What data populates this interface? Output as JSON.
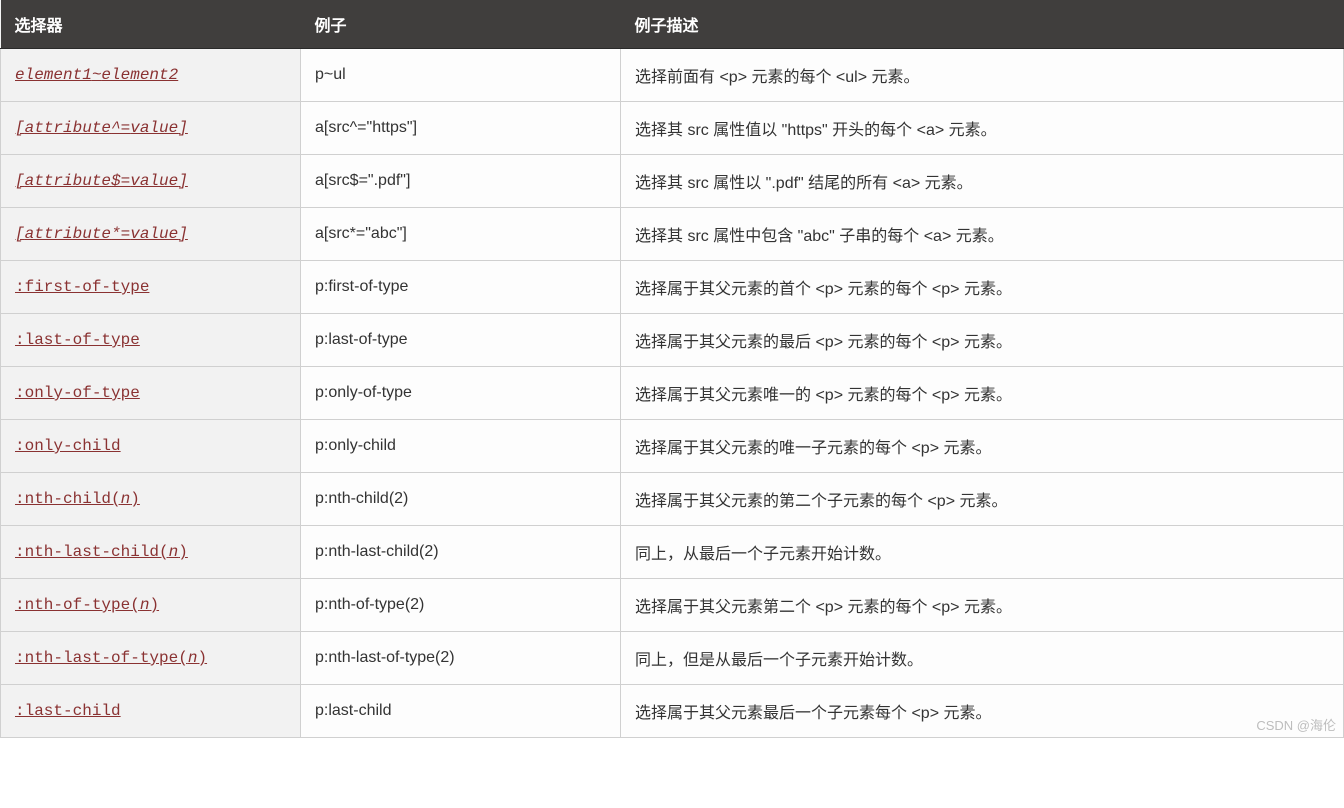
{
  "headers": {
    "col1": "选择器",
    "col2": "例子",
    "col3": "例子描述"
  },
  "rows": [
    {
      "selector_html": "<span class='arg'>element1</span>~<span class='arg'>element2</span>",
      "italic": true,
      "example": "p~ul",
      "desc": "选择前面有 <p> 元素的每个 <ul> 元素。"
    },
    {
      "selector_html": "[<span class='arg'>attribute</span>^=<span class='arg'>value</span>]",
      "italic": true,
      "example": "a[src^=\"https\"]",
      "desc": "选择其 src 属性值以 \"https\" 开头的每个 <a> 元素。"
    },
    {
      "selector_html": "[<span class='arg'>attribute</span>$=<span class='arg'>value</span>]",
      "italic": true,
      "example": "a[src$=\".pdf\"]",
      "desc": "选择其 src 属性以 \".pdf\" 结尾的所有 <a> 元素。"
    },
    {
      "selector_html": "[<span class='arg'>attribute</span>*=<span class='arg'>value</span>]",
      "italic": true,
      "example": "a[src*=\"abc\"]",
      "desc": "选择其 src 属性中包含 \"abc\" 子串的每个 <a> 元素。"
    },
    {
      "selector_html": ":first-of-type",
      "italic": false,
      "example": "p:first-of-type",
      "desc": "选择属于其父元素的首个 <p> 元素的每个 <p> 元素。"
    },
    {
      "selector_html": ":last-of-type",
      "italic": false,
      "example": "p:last-of-type",
      "desc": "选择属于其父元素的最后 <p> 元素的每个 <p> 元素。"
    },
    {
      "selector_html": ":only-of-type",
      "italic": false,
      "example": "p:only-of-type",
      "desc": "选择属于其父元素唯一的 <p> 元素的每个 <p> 元素。"
    },
    {
      "selector_html": ":only-child",
      "italic": false,
      "example": "p:only-child",
      "desc": "选择属于其父元素的唯一子元素的每个 <p> 元素。"
    },
    {
      "selector_html": ":nth-child(<span class='arg'>n</span>)",
      "italic": false,
      "example": "p:nth-child(2)",
      "desc": "选择属于其父元素的第二个子元素的每个 <p> 元素。"
    },
    {
      "selector_html": ":nth-last-child(<span class='arg'>n</span>)",
      "italic": false,
      "example": "p:nth-last-child(2)",
      "desc": "同上，从最后一个子元素开始计数。"
    },
    {
      "selector_html": ":nth-of-type(<span class='arg'>n</span>)",
      "italic": false,
      "example": "p:nth-of-type(2)",
      "desc": "选择属于其父元素第二个 <p> 元素的每个 <p> 元素。"
    },
    {
      "selector_html": ":nth-last-of-type(<span class='arg'>n</span>)",
      "italic": false,
      "example": "p:nth-last-of-type(2)",
      "desc": "同上，但是从最后一个子元素开始计数。"
    },
    {
      "selector_html": ":last-child",
      "italic": false,
      "example": "p:last-child",
      "desc": "选择属于其父元素最后一个子元素每个 <p> 元素。"
    }
  ],
  "watermark": "CSDN @海伦"
}
